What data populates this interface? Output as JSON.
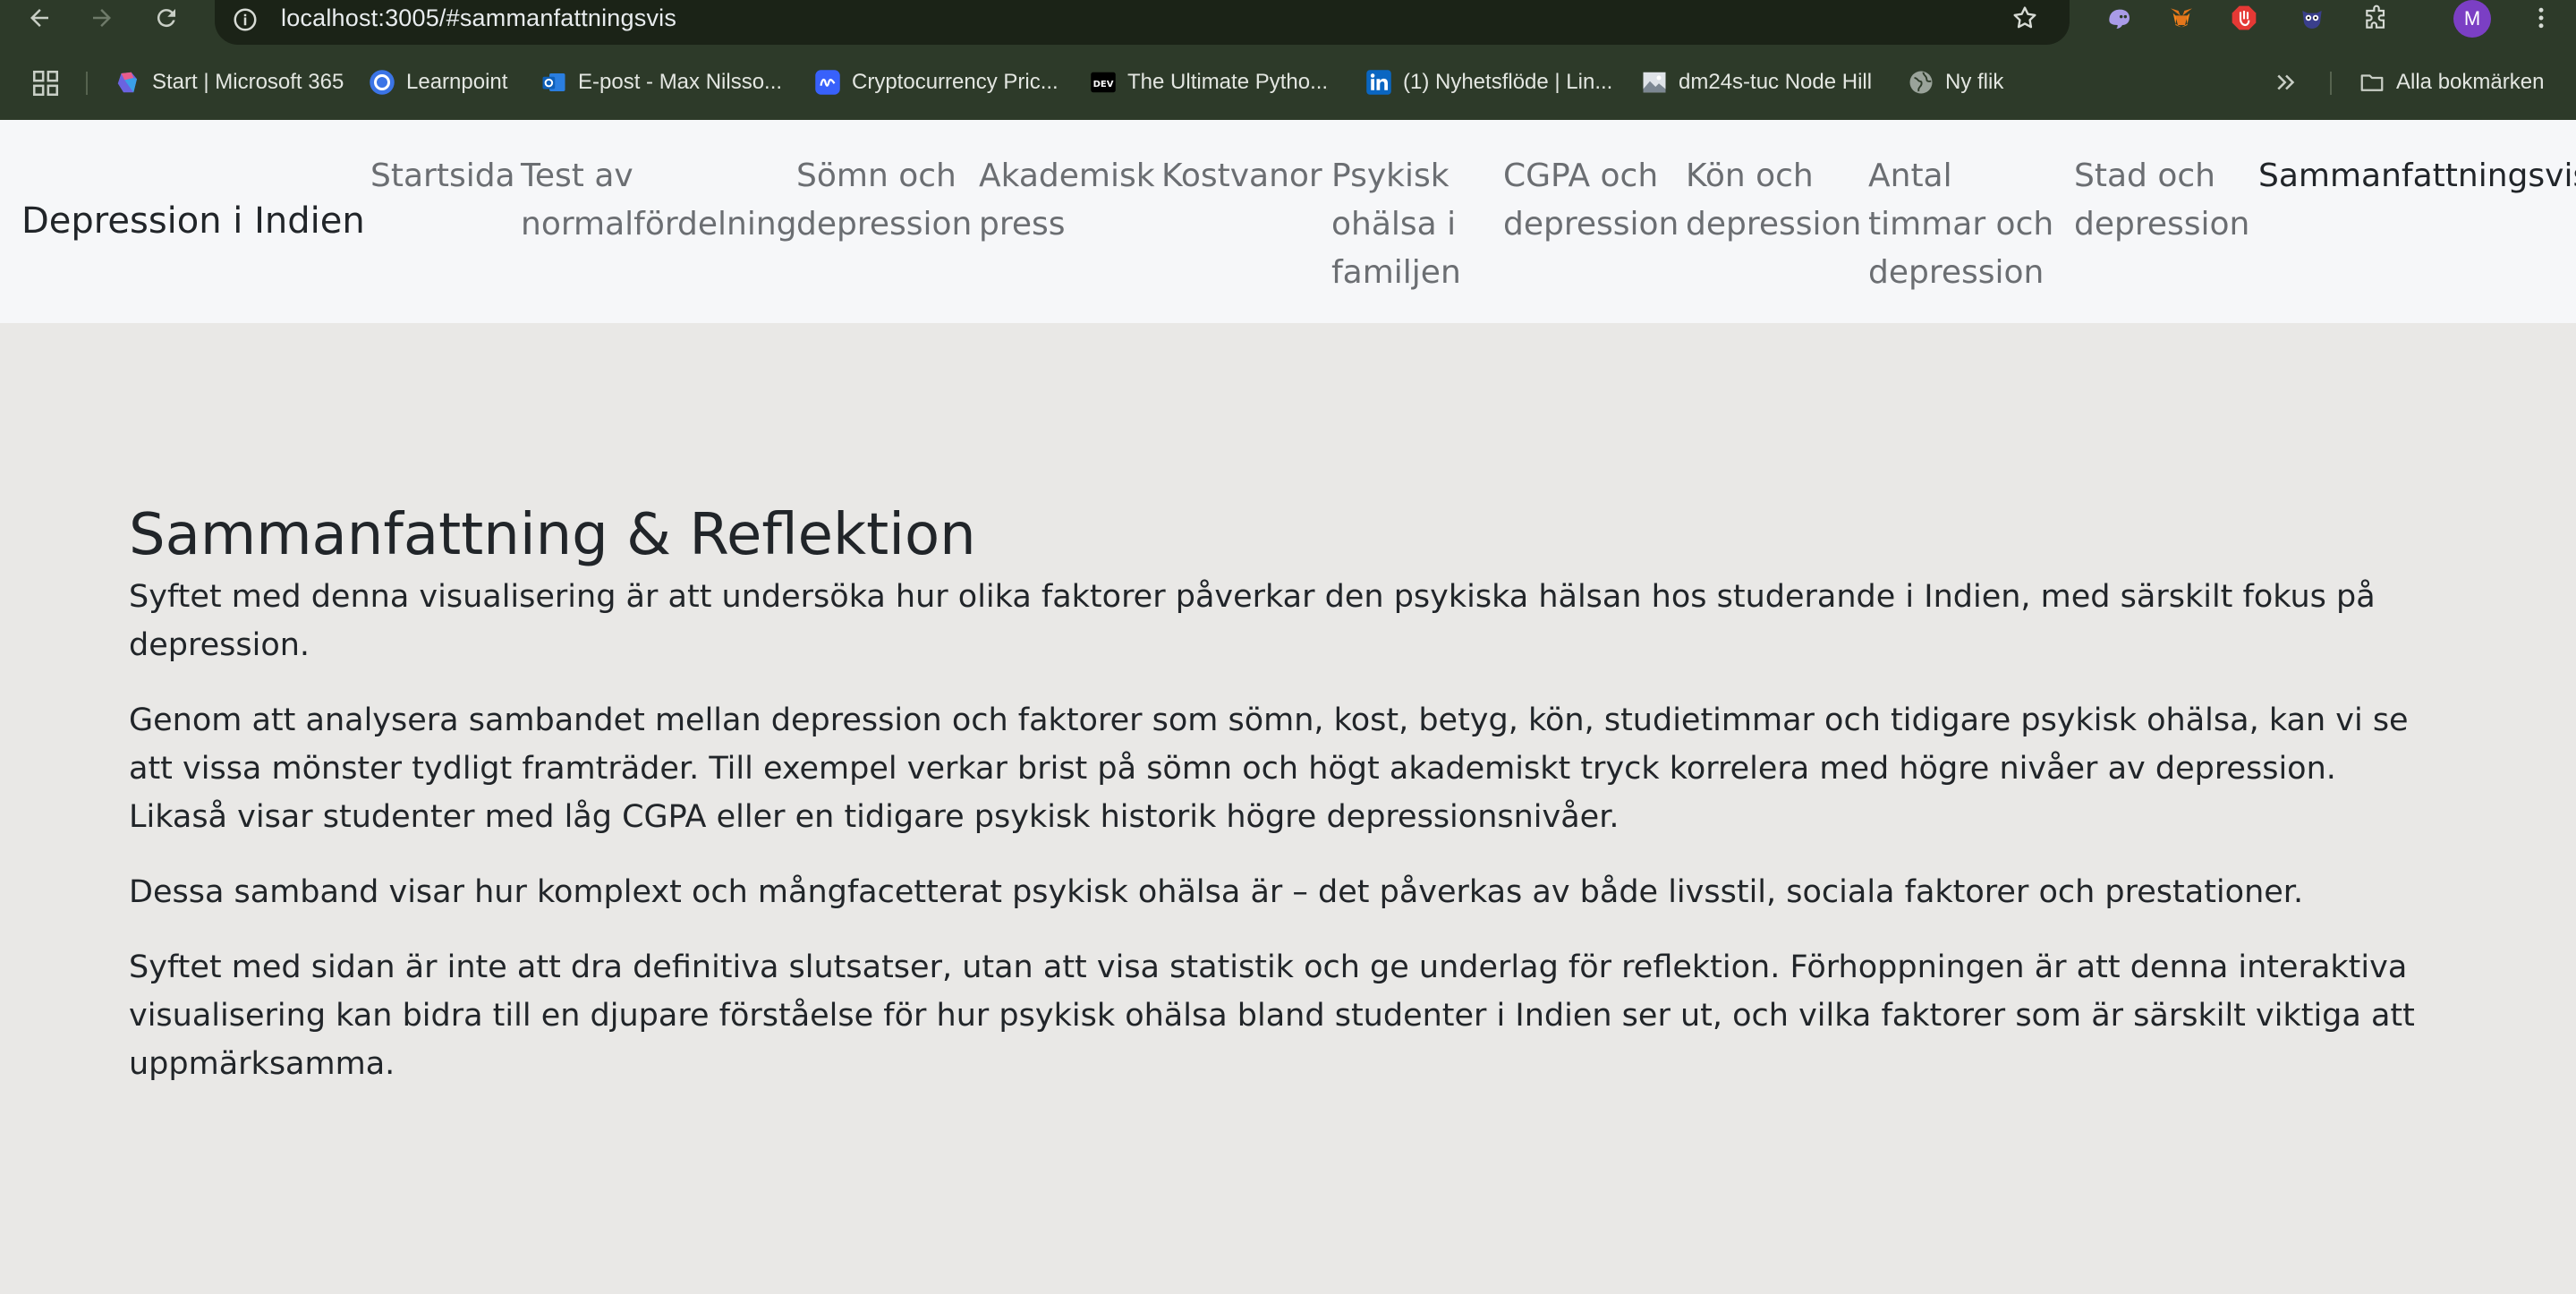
{
  "browser": {
    "url": "localhost:3005/#sammanfattningsvis",
    "profile_initial": "M",
    "bookmarks": [
      {
        "label": "Start | Microsoft 365",
        "icon": "microsoft365-icon"
      },
      {
        "label": "Learnpoint",
        "icon": "learnpoint-icon"
      },
      {
        "label": "E-post - Max Nilsso...",
        "icon": "outlook-icon"
      },
      {
        "label": "Cryptocurrency Pric...",
        "icon": "coinmarketcap-icon"
      },
      {
        "label": "The Ultimate Pytho...",
        "icon": "dev-icon"
      },
      {
        "label": "(1) Nyhetsflöde | Lin...",
        "icon": "linkedin-icon"
      },
      {
        "label": "dm24s-tuc Node Hill",
        "icon": "image-icon"
      },
      {
        "label": "Ny flik",
        "icon": "globe-icon"
      }
    ],
    "all_bookmarks_label": "Alla bokmärken"
  },
  "nav": {
    "brand": "Depression i Indien",
    "items": [
      {
        "label": "Startsida",
        "active": false
      },
      {
        "label": "Test av normalfördelning",
        "active": false
      },
      {
        "label": "Sömn och depression",
        "active": false
      },
      {
        "label": "Akademisk press",
        "active": false
      },
      {
        "label": "Kostvanor",
        "active": false
      },
      {
        "label": "Psykisk ohälsa i familjen",
        "active": false
      },
      {
        "label": "CGPA och depression",
        "active": false
      },
      {
        "label": "Kön och depression",
        "active": false
      },
      {
        "label": "Antal timmar och depression",
        "active": false
      },
      {
        "label": "Stad och depression",
        "active": false
      },
      {
        "label": "Sammanfattningsvis",
        "active": true
      }
    ]
  },
  "main": {
    "title": "Sammanfattning & Reflektion",
    "paragraphs": [
      "Syftet med denna visualisering är att undersöka hur olika faktorer påverkar den psykiska hälsan hos studerande i Indien, med särskilt fokus på depression.",
      "Genom att analysera sambandet mellan depression och faktorer som sömn, kost, betyg, kön, studietimmar och tidigare psykisk ohälsa, kan vi se att vissa mönster tydligt framträder. Till exempel verkar brist på sömn och högt akademiskt tryck korrelera med högre nivåer av depression. Likaså visar studenter med låg CGPA eller en tidigare psykisk historik högre depressionsnivåer.",
      "Dessa samband visar hur komplext och mångfacetterat psykisk ohälsa är – det påverkas av både livsstil, sociala faktorer och prestationer.",
      "Syftet med sidan är inte att dra definitiva slutsatser, utan att visa statistik och ge underlag för reflektion. Förhoppningen är att denna interaktiva visualisering kan bidra till en djupare förståelse för hur psykisk ohälsa bland studenter i Indien ser ut, och vilka faktorer som är särskilt viktiga att uppmärksamma."
    ]
  }
}
